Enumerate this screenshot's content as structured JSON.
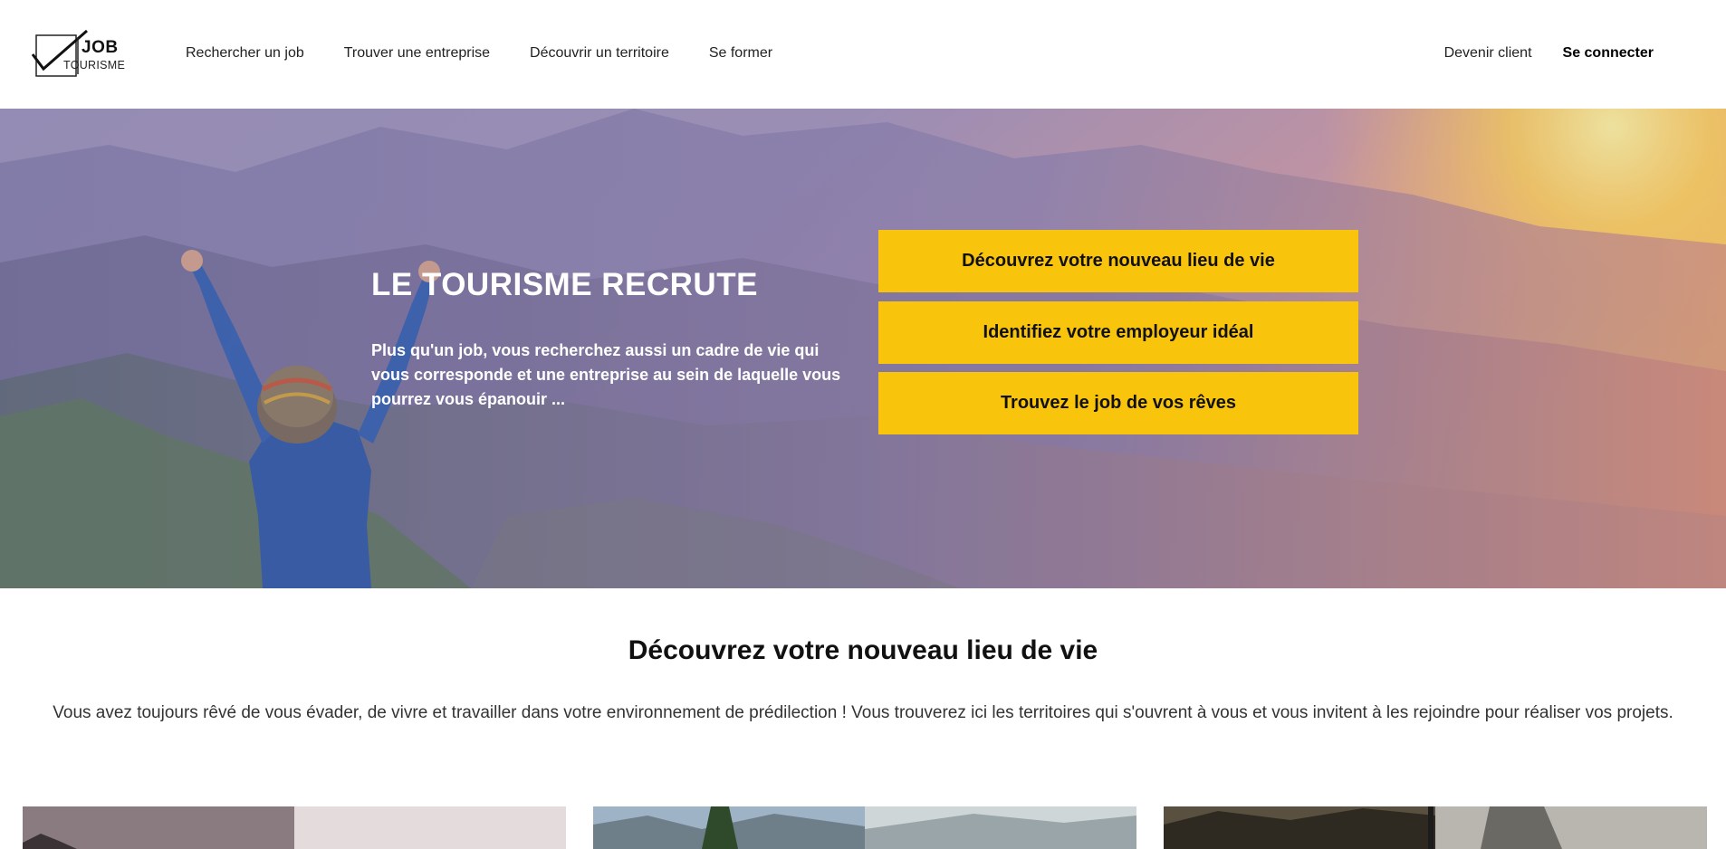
{
  "header": {
    "logo_job": "JOB",
    "logo_tourisme": "TOURISME",
    "nav": [
      {
        "label": "Rechercher un job"
      },
      {
        "label": "Trouver une entreprise"
      },
      {
        "label": "Découvrir un territoire"
      },
      {
        "label": "Se former"
      }
    ],
    "become_client": "Devenir client",
    "login": "Se connecter"
  },
  "hero": {
    "title": "LE TOURISME RECRUTE",
    "text": "Plus qu'un job, vous recherchez aussi un cadre de vie qui vous corresponde et une entreprise au sein de laquelle vous pourrez vous épanouir ...",
    "buttons": [
      {
        "label": "Découvrez votre nouveau lieu de vie"
      },
      {
        "label": "Identifiez votre employeur idéal"
      },
      {
        "label": "Trouvez le job de vos rêves"
      }
    ]
  },
  "section": {
    "title": "Découvrez votre nouveau lieu de vie",
    "text": "Vous avez toujours rêvé de vous évader, de vivre et travailler dans votre environnement de prédilection ! Vous trouverez ici les territoires qui s'ouvrent à vous et vous invitent à les rejoindre pour réaliser vos projets."
  },
  "colors": {
    "accent": "#f9c40c",
    "text_dark": "#111111",
    "hero_text": "#ffffff"
  }
}
